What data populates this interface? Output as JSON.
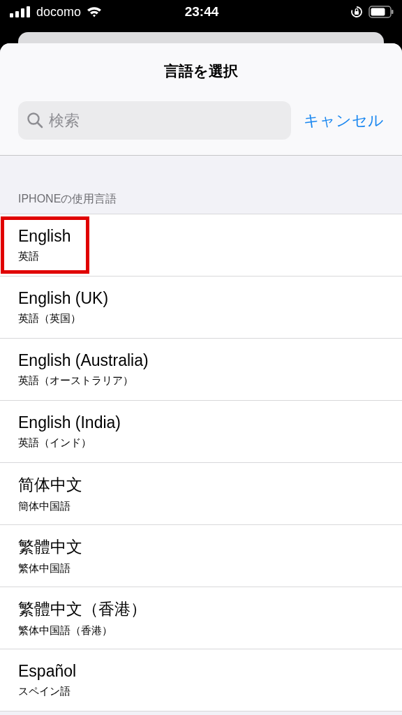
{
  "status_bar": {
    "carrier": "docomo",
    "time": "23:44"
  },
  "sheet": {
    "title": "言語を選択"
  },
  "search": {
    "placeholder": "検索",
    "cancel": "キャンセル"
  },
  "section": {
    "header": "IPHONEの使用言語",
    "items": [
      {
        "name": "English",
        "subtitle": "英語",
        "highlighted": true
      },
      {
        "name": "English (UK)",
        "subtitle": "英語（英国）",
        "highlighted": false
      },
      {
        "name": "English (Australia)",
        "subtitle": "英語（オーストラリア）",
        "highlighted": false
      },
      {
        "name": "English (India)",
        "subtitle": "英語（インド）",
        "highlighted": false
      },
      {
        "name": "简体中文",
        "subtitle": "簡体中国語",
        "highlighted": false
      },
      {
        "name": "繁體中文",
        "subtitle": "繁体中国語",
        "highlighted": false
      },
      {
        "name": "繁體中文（香港）",
        "subtitle": "繁体中国語（香港）",
        "highlighted": false
      },
      {
        "name": "Español",
        "subtitle": "スペイン語",
        "highlighted": false
      }
    ]
  }
}
